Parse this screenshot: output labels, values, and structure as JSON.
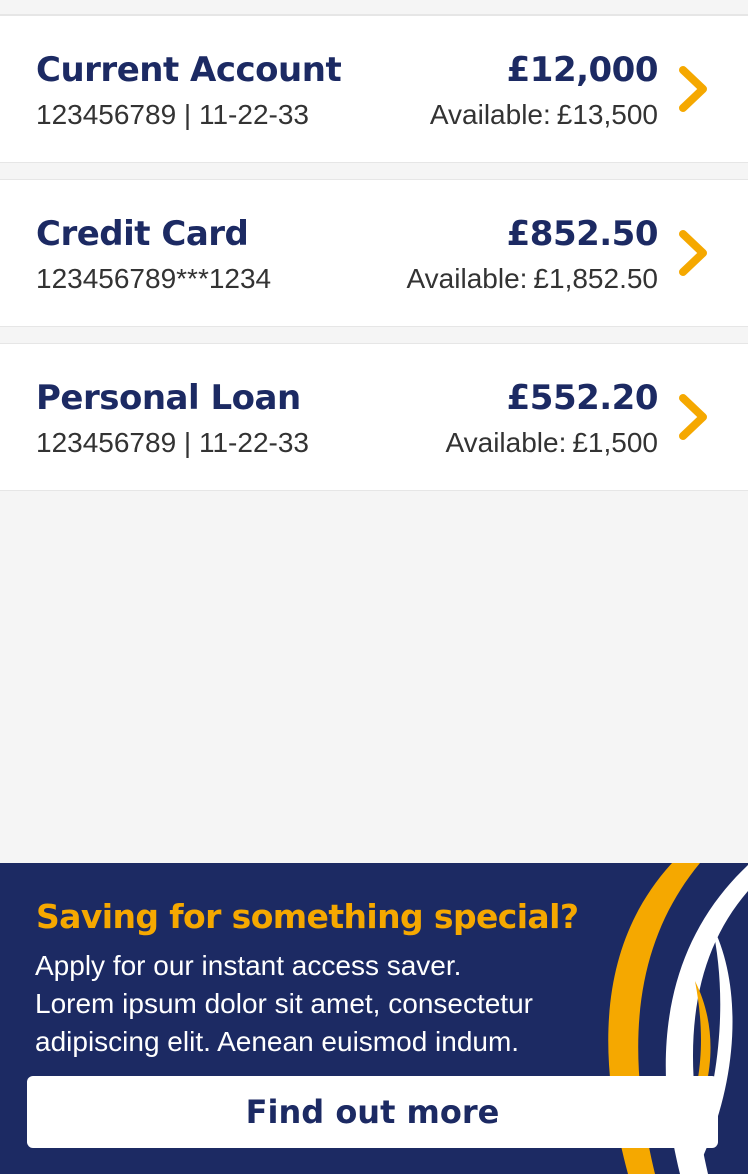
{
  "accounts": [
    {
      "name": "Current Account",
      "number": "123456789 | 11-22-33",
      "balance": "£12,000",
      "available_label": "Available:",
      "available_value": "£13,500"
    },
    {
      "name": "Credit Card",
      "number": "123456789***1234",
      "balance": "£852.50",
      "available_label": "Available:",
      "available_value": "£1,852.50"
    },
    {
      "name": "Personal Loan",
      "number": "123456789 | 11-22-33",
      "balance": "£552.20",
      "available_label": "Available:",
      "available_value": "£1,500"
    }
  ],
  "promo": {
    "title": "Saving for something special?",
    "body_lines": [
      "Apply for our instant access saver.",
      "Lorem ipsum dolor sit amet, consectetur",
      "adipiscing elit. Aenean euismod indum."
    ],
    "button_label": "Find out more"
  },
  "icons": {
    "chevron": "chevron-right-icon"
  },
  "colors": {
    "brand_navy": "#1c2a63",
    "accent_gold": "#f5a800",
    "background": "#f5f5f5",
    "card": "#ffffff"
  }
}
